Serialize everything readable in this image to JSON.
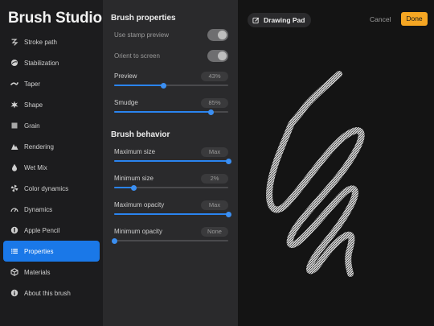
{
  "app": {
    "title": "Brush Studio"
  },
  "sidebar": {
    "items": [
      {
        "label": "Stroke path",
        "icon": "stroke-path-icon"
      },
      {
        "label": "Stabilization",
        "icon": "stabilization-icon"
      },
      {
        "label": "Taper",
        "icon": "taper-icon"
      },
      {
        "label": "Shape",
        "icon": "shape-icon"
      },
      {
        "label": "Grain",
        "icon": "grain-icon"
      },
      {
        "label": "Rendering",
        "icon": "rendering-icon"
      },
      {
        "label": "Wet Mix",
        "icon": "wet-mix-icon"
      },
      {
        "label": "Color dynamics",
        "icon": "color-dynamics-icon"
      },
      {
        "label": "Dynamics",
        "icon": "dynamics-icon"
      },
      {
        "label": "Apple Pencil",
        "icon": "apple-pencil-icon"
      },
      {
        "label": "Properties",
        "icon": "properties-icon",
        "active": true
      },
      {
        "label": "Materials",
        "icon": "materials-icon"
      },
      {
        "label": "About this brush",
        "icon": "info-icon"
      }
    ]
  },
  "properties": {
    "section_title": "Brush properties",
    "use_stamp_preview": {
      "label": "Use stamp preview",
      "on": false
    },
    "orient_to_screen": {
      "label": "Orient to screen",
      "on": false
    },
    "preview": {
      "label": "Preview",
      "value": "43%",
      "level": 0.43
    },
    "smudge": {
      "label": "Smudge",
      "value": "85%",
      "level": 0.85
    }
  },
  "behavior": {
    "section_title": "Brush behavior",
    "maximum_size": {
      "label": "Maximum size",
      "value": "Max",
      "level": 1.0
    },
    "minimum_size": {
      "label": "Minimum size",
      "value": "2%",
      "level": 0.17
    },
    "maximum_opacity": {
      "label": "Maximum opacity",
      "value": "Max",
      "level": 1.0
    },
    "minimum_opacity": {
      "label": "Minimum opacity",
      "value": "None",
      "level": 0.0
    }
  },
  "pad": {
    "tab_label": "Drawing Pad",
    "cancel_label": "Cancel",
    "done_label": "Done"
  },
  "colors": {
    "accent": "#1a78e8",
    "done": "#f5a623",
    "slider": "#2a84f0"
  }
}
